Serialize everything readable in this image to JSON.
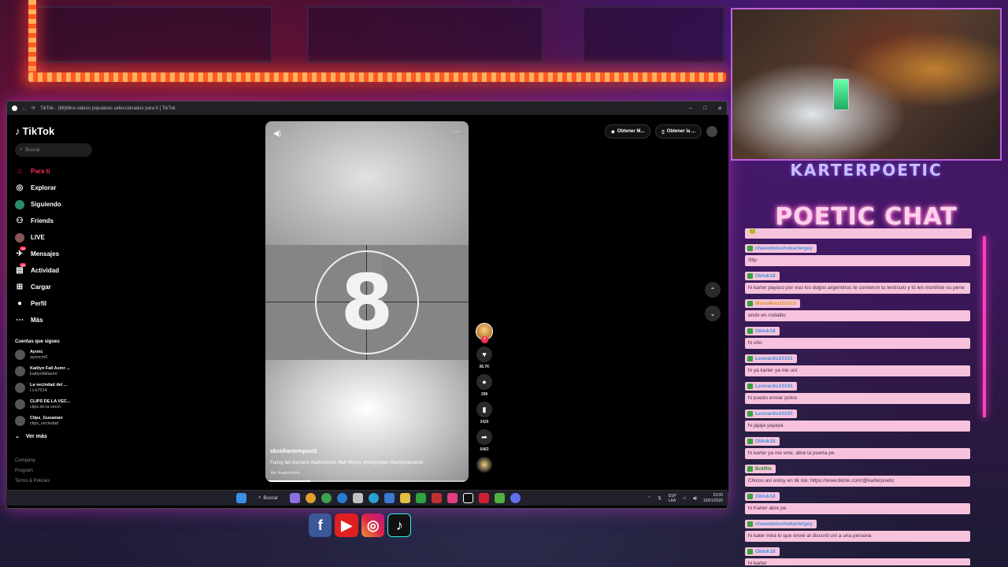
{
  "browser": {
    "tab_title": "TikTok - (68)Mira videos populares seleccionados para ti | TikTok",
    "window_controls": [
      "–",
      "□",
      "✕"
    ]
  },
  "tiktok": {
    "logo": "TikTok",
    "search_placeholder": "Buscar",
    "nav": [
      {
        "label": "Para ti",
        "icon": "home-icon",
        "active": true
      },
      {
        "label": "Explorar",
        "icon": "compass-icon"
      },
      {
        "label": "Siguiendo",
        "icon": "following-icon"
      },
      {
        "label": "Friends",
        "icon": "friends-icon"
      },
      {
        "label": "LIVE",
        "icon": "live-icon"
      },
      {
        "label": "Mensajes",
        "icon": "messages-icon",
        "badge": "14"
      },
      {
        "label": "Actividad",
        "icon": "activity-icon",
        "badge": "44"
      },
      {
        "label": "Cargar",
        "icon": "upload-icon"
      },
      {
        "label": "Perfil",
        "icon": "profile-icon"
      },
      {
        "label": "Más",
        "icon": "more-icon"
      }
    ],
    "following_title": "Cuentas que sigues",
    "following": [
      {
        "name": "Ayonc",
        "handle": "ayoncm0"
      },
      {
        "name": "Kaitlyn Fall Asmr ...",
        "handle": "kaitlynfallasmr"
      },
      {
        "name": "La vecindad del ...",
        "handle": "l.v.k7914"
      },
      {
        "name": "CLIPS DE LA VEC...",
        "handle": "clips.de.la.vecin"
      },
      {
        "name": "Clips_Gusaman",
        "handle": "clips_vecindad"
      }
    ],
    "see_more": "Ver más",
    "footer": [
      "Company",
      "Program",
      "Terms & Policies"
    ],
    "top_buttons": [
      "Obtener M...",
      "Obtener la ..."
    ],
    "video": {
      "countdown": "8",
      "author": "obsidiantempest2",
      "description": "Funny fail moment #failmoment #fail #funny #funnyvideo #funnymoments",
      "translate": "Ver traducción",
      "progress": 0.22
    },
    "actions": [
      {
        "icon": "heart-icon",
        "count": "38.7K"
      },
      {
        "icon": "comment-icon",
        "count": "298"
      },
      {
        "icon": "bookmark-icon",
        "count": "3426"
      },
      {
        "icon": "share-icon",
        "count": "6483"
      }
    ]
  },
  "taskbar": {
    "search": "Buscar",
    "lang": "ESP\nLAA",
    "time": "23:00",
    "date": "15/01/2026"
  },
  "stream": {
    "streamer": "KARTERPOETIC",
    "chat_title": "POETIC CHAT",
    "first_message": "🐸",
    "messages": [
      {
        "user": "chavodelochokartergey",
        "text": "Slip",
        "type": "user"
      },
      {
        "user": "Obluk18",
        "text": "hi karter payaso por eso los dogos argentinos te comieron tu testículo y tú les mordiste su pene",
        "type": "user"
      },
      {
        "user": "MunoMan101010",
        "text": "ando en codalito",
        "type": "mod"
      },
      {
        "user": "Obluk18",
        "text": "hi oño",
        "type": "user"
      },
      {
        "user": "Leonardo10101",
        "text": "hi ya karter ya me uní",
        "type": "user"
      },
      {
        "user": "Leonardo10101",
        "text": "hi puedo enviar potos",
        "type": "user"
      },
      {
        "user": "Leonardo10101",
        "text": "hi jajaja yayaya",
        "type": "user"
      },
      {
        "user": "Obluk18",
        "text": "hi karter ya me vine, abre la puerta pe",
        "type": "user"
      },
      {
        "user": "BotRix",
        "text": "Chicos así estoy en tik tok: https://www.tiktok.com/@karterpoetic",
        "type": "bot"
      },
      {
        "user": "Obluk18",
        "text": "hi Karter abre pe",
        "type": "user"
      },
      {
        "user": "chavodelochokartergey",
        "text": "hi kater mira lo que envié al discord uní a una persona",
        "type": "user"
      },
      {
        "user": "Obluk18",
        "text": "hi karter",
        "type": "user"
      }
    ]
  },
  "social": [
    "f",
    "▶",
    "◎",
    "♪"
  ],
  "colors": {
    "tiktok_red": "#fe2c55",
    "chat_pink": "#f7c3dc",
    "neon": "#ff40c0"
  }
}
